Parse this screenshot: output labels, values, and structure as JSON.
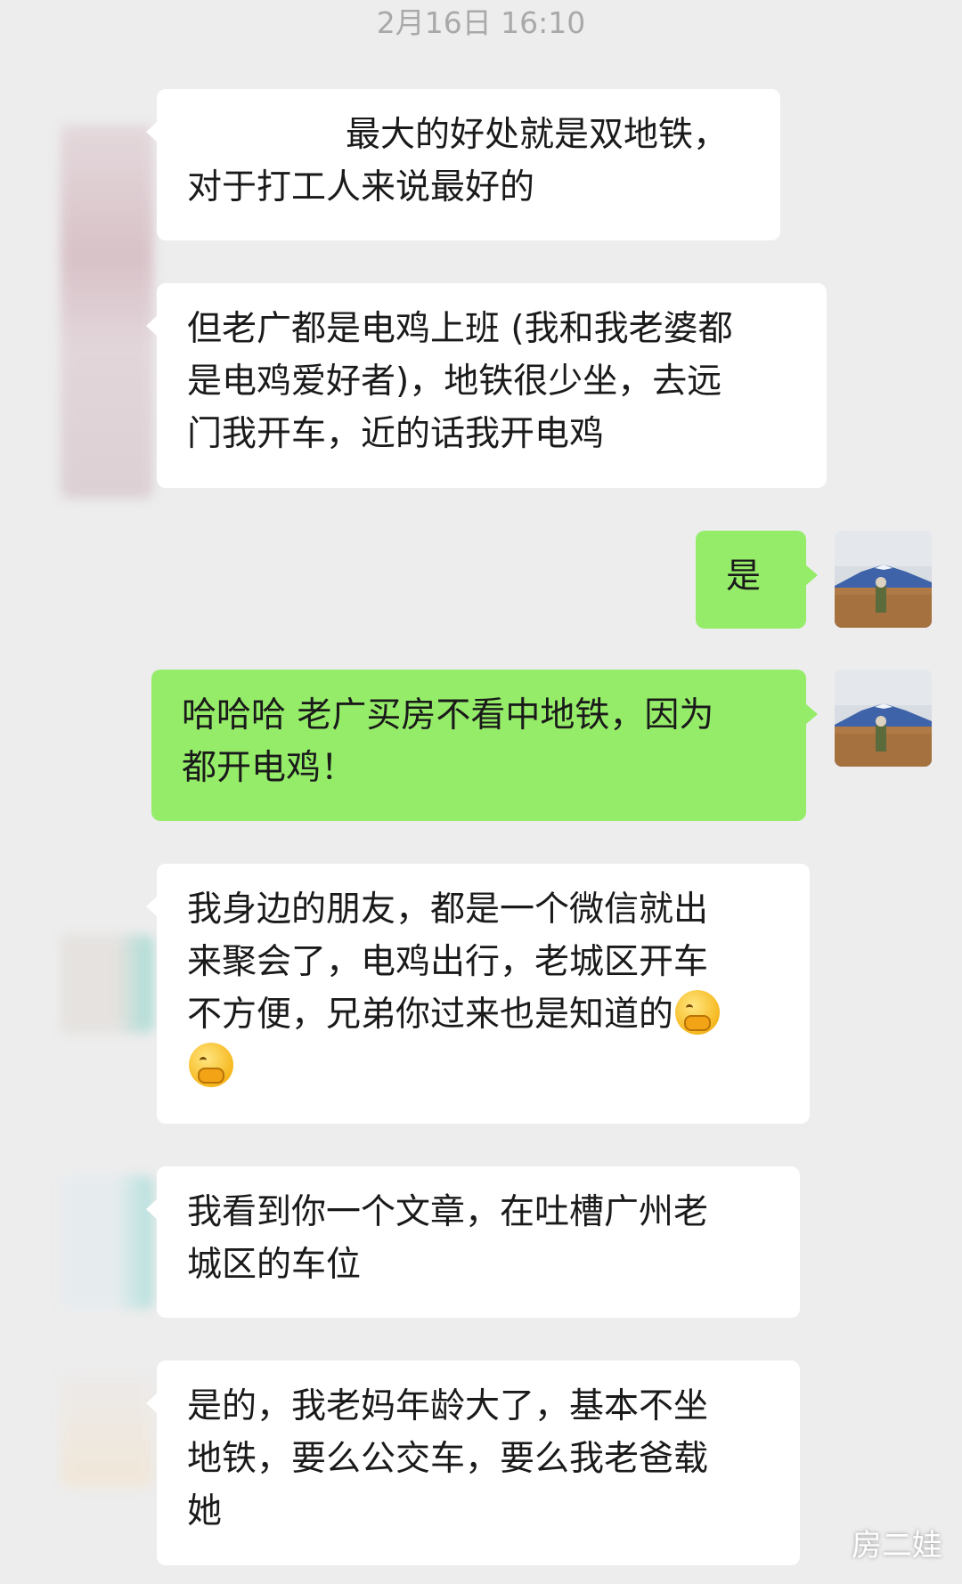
{
  "timestamp": "2月16日 16:10",
  "messages": [
    {
      "side": "in",
      "text": "最大的好处就是双地铁，\n对于打工人来说最好的"
    },
    {
      "side": "in",
      "text": "但老广都是电鸡上班 (我和我老婆都\n是电鸡爱好者)，地铁很少坐，去远\n门我开车，近的话我开电鸡"
    },
    {
      "side": "out",
      "text": "是"
    },
    {
      "side": "out",
      "text": "哈哈哈 老广买房不看中地铁，因为\n都开电鸡！"
    },
    {
      "side": "in",
      "text": "我身边的朋友，都是一个微信就出\n来聚会了，电鸡出行，老城区开车\n不方便，兄弟你过来也是知道的",
      "emoji": "thinking-face"
    },
    {
      "side": "in",
      "text": "我看到你一个文章，在吐槽广州老\n城区的车位"
    },
    {
      "side": "in",
      "text": "是的，我老妈年龄大了，基本不坐\n地铁，要么公交车，要么我老爸载\n她"
    }
  ],
  "watermark": "房二娃",
  "colors": {
    "background": "#ededed",
    "incoming_bubble": "#ffffff",
    "outgoing_bubble": "#95ec69",
    "timestamp": "#a9a9a9"
  }
}
